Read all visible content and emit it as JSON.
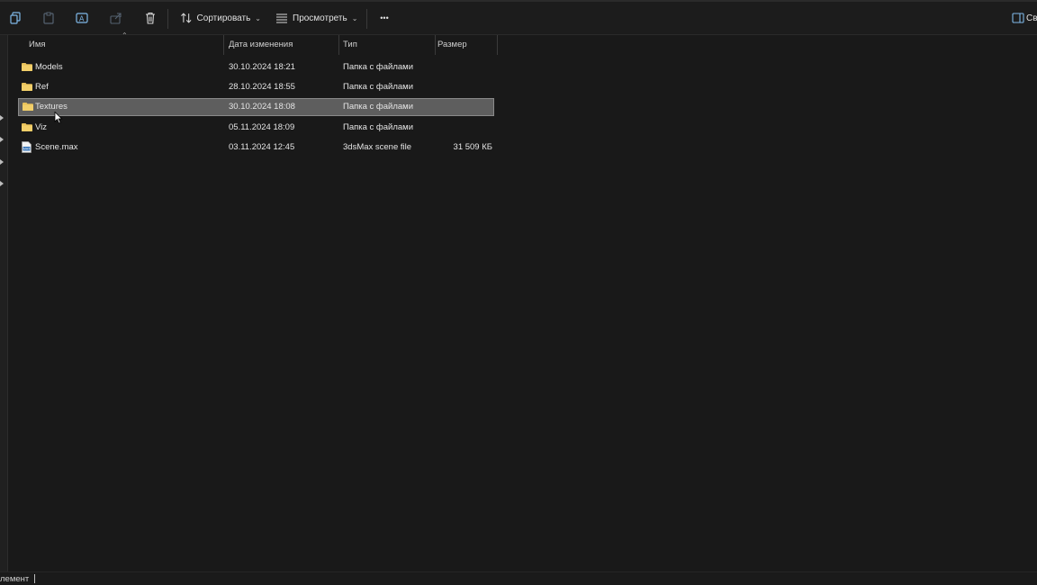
{
  "toolbar": {
    "sort_label": "Сортировать",
    "view_label": "Просмотреть",
    "more_label": "•••",
    "details_label": "Св"
  },
  "columns": {
    "name": "Имя",
    "date": "Дата изменения",
    "type": "Тип",
    "size": "Размер"
  },
  "files": [
    {
      "name": "Models",
      "date": "30.10.2024 18:21",
      "type": "Папка с файлами",
      "size": "",
      "kind": "folder",
      "selected": false
    },
    {
      "name": "Ref",
      "date": "28.10.2024 18:55",
      "type": "Папка с файлами",
      "size": "",
      "kind": "folder",
      "selected": false
    },
    {
      "name": "Textures",
      "date": "30.10.2024 18:08",
      "type": "Папка с файлами",
      "size": "",
      "kind": "folder",
      "selected": true
    },
    {
      "name": "Viz",
      "date": "05.11.2024 18:09",
      "type": "Папка с файлами",
      "size": "",
      "kind": "folder",
      "selected": false
    },
    {
      "name": "Scene.max",
      "date": "03.11.2024 12:45",
      "type": "3dsMax scene file",
      "size": "31 509 КБ",
      "kind": "file",
      "selected": false
    }
  ],
  "status": {
    "text": "лемент"
  },
  "colors": {
    "background": "#191919",
    "selection": "#5e5e5e",
    "folder": "#e8c15a"
  }
}
